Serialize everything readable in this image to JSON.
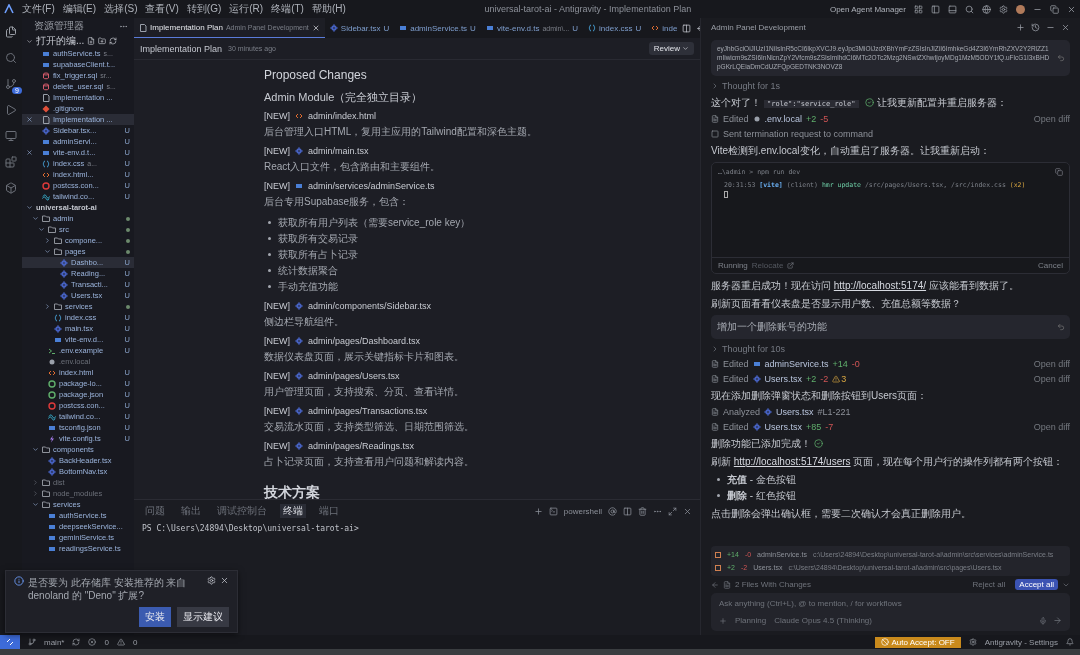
{
  "title_bar": {
    "menu": [
      "文件(F)",
      "编辑(E)",
      "选择(S)",
      "查看(V)",
      "转到(G)",
      "运行(R)",
      "终端(T)",
      "帮助(H)"
    ],
    "title": "universal-tarot-ai - Antigravity - Implementation Plan",
    "agent_manager": "Open Agent Manager"
  },
  "activity_bar": {
    "scm_badge": "9"
  },
  "explorer": {
    "title": "资源管理器",
    "open_editors_label": "打开的编...",
    "open_editors": [
      {
        "name": "authService.ts",
        "detail": "s...",
        "kind": "ts",
        "selected": false,
        "closable": false
      },
      {
        "name": "supabaseClient.t...",
        "kind": "ts",
        "selected": false,
        "closable": false
      },
      {
        "name": "fix_trigger.sql",
        "detail": "sr...",
        "kind": "sql",
        "selected": false,
        "closable": false
      },
      {
        "name": "delete_user.sql",
        "detail": "s...",
        "kind": "sql",
        "selected": false,
        "closable": false
      },
      {
        "name": "Implementation ...",
        "kind": "md",
        "selected": false,
        "closable": false
      },
      {
        "name": ".gitignore",
        "kind": "git",
        "selected": false,
        "closable": false
      },
      {
        "name": "Implementation ...",
        "kind": "md",
        "selected": true,
        "closable": true
      },
      {
        "name": "Sidebar.tsx...",
        "badge": "U",
        "kind": "tsx",
        "selected": false,
        "closable": false
      },
      {
        "name": "adminServi...",
        "badge": "U",
        "kind": "ts",
        "selected": false,
        "closable": false
      },
      {
        "name": "vite-env.d.t...",
        "badge": "U",
        "kind": "ts",
        "selected": false,
        "closable": true
      },
      {
        "name": "index.css",
        "detail": "a...",
        "badge": "U",
        "kind": "css",
        "selected": false,
        "closable": false
      },
      {
        "name": "index.html...",
        "badge": "U",
        "kind": "html",
        "selected": false,
        "closable": false
      },
      {
        "name": "postcss.con...",
        "badge": "U",
        "kind": "postcss",
        "selected": false,
        "closable": false
      },
      {
        "name": "tailwind.co...",
        "badge": "U",
        "kind": "tailwind",
        "selected": false,
        "closable": false
      }
    ],
    "tree": [
      {
        "name": "universal-tarot-ai",
        "kind": "root",
        "expanded": true,
        "children": [
          {
            "name": "admin",
            "kind": "folder",
            "expanded": true,
            "modified": true,
            "children": [
              {
                "name": "src",
                "kind": "folder",
                "expanded": true,
                "modified": true,
                "children": [
                  {
                    "name": "compone...",
                    "kind": "folder",
                    "expanded": false,
                    "modified": true
                  },
                  {
                    "name": "pages",
                    "kind": "folder",
                    "expanded": true,
                    "modified": true,
                    "children": [
                      {
                        "name": "Dashbo...",
                        "kind": "tsx",
                        "badge": "U",
                        "selected": true
                      },
                      {
                        "name": "Reading...",
                        "kind": "tsx",
                        "badge": "U",
                        "selected": false
                      },
                      {
                        "name": "Transacti...",
                        "kind": "tsx",
                        "badge": "U",
                        "selected": false
                      },
                      {
                        "name": "Users.tsx",
                        "kind": "tsx",
                        "badge": "U",
                        "selected": false
                      }
                    ]
                  },
                  {
                    "name": "services",
                    "kind": "folder",
                    "expanded": false,
                    "modified": true
                  },
                  {
                    "name": "index.css",
                    "kind": "css",
                    "badge": "U"
                  },
                  {
                    "name": "main.tsx",
                    "kind": "tsx",
                    "badge": "U"
                  },
                  {
                    "name": "vite-env.d...",
                    "kind": "ts",
                    "badge": "U"
                  }
                ]
              },
              {
                "name": ".env.example",
                "kind": "sh",
                "badge": "U"
              },
              {
                "name": ".env.local",
                "kind": "env",
                "ignored": true
              },
              {
                "name": "index.html",
                "kind": "html",
                "badge": "U"
              },
              {
                "name": "package-lo...",
                "kind": "json",
                "badge": "U"
              },
              {
                "name": "package.json",
                "kind": "json",
                "badge": "U"
              },
              {
                "name": "postcss.con...",
                "kind": "postcss",
                "badge": "U"
              },
              {
                "name": "tailwind.co...",
                "kind": "tailwind",
                "badge": "U"
              },
              {
                "name": "tsconfig.json",
                "kind": "ts",
                "badge": "U"
              },
              {
                "name": "vite.config.ts",
                "kind": "vite",
                "badge": "U"
              }
            ]
          },
          {
            "name": "components",
            "kind": "folder",
            "expanded": true,
            "children": [
              {
                "name": "BackHeader.tsx",
                "kind": "tsx"
              },
              {
                "name": "BottomNav.tsx",
                "kind": "tsx"
              }
            ]
          },
          {
            "name": "dist",
            "kind": "folder",
            "expanded": false,
            "ignored": true
          },
          {
            "name": "node_modules",
            "kind": "folder",
            "expanded": false,
            "ignored": true
          },
          {
            "name": "services",
            "kind": "folder",
            "expanded": true,
            "children": [
              {
                "name": "authService.ts",
                "kind": "ts"
              },
              {
                "name": "deepseekService...",
                "kind": "ts"
              },
              {
                "name": "geminiService.ts",
                "kind": "ts"
              },
              {
                "name": "readingsService.ts",
                "kind": "ts"
              }
            ]
          }
        ]
      }
    ]
  },
  "editor": {
    "tabs": [
      {
        "label": "Implementation Plan",
        "detail": "Admin Panel Development",
        "kind": "md",
        "selected": true
      },
      {
        "label": "Sidebar.tsx",
        "badge": "U",
        "kind": "tsx",
        "selected": false
      },
      {
        "label": "adminService.ts",
        "badge": "U",
        "kind": "ts",
        "selected": false
      },
      {
        "label": "vite-env.d.ts",
        "detail": "admin\\...",
        "badge": "U",
        "kind": "ts",
        "selected": false
      },
      {
        "label": "index.css",
        "badge": "U",
        "kind": "css",
        "selected": false
      },
      {
        "label": "inde",
        "kind": "html",
        "selected": false
      }
    ],
    "doc_title": "Implementation Plan",
    "doc_time": "30 minutes ago",
    "review": "Review",
    "heading": "Proposed Changes",
    "subheading": "Admin Module（完全独立目录）",
    "changes": [
      {
        "tag": "[NEW]",
        "kind": "html",
        "path": "admin/index.html",
        "description": "后台管理入口HTML，复用主应用的Tailwind配置和深色主题。"
      },
      {
        "tag": "[NEW]",
        "kind": "tsx",
        "path": "admin/main.tsx",
        "description": "React入口文件，包含路由和主要组件。"
      },
      {
        "tag": "[NEW]",
        "kind": "ts",
        "path": "admin/services/adminService.ts",
        "description": "后台专用Supabase服务，包含：",
        "bullets": [
          "获取所有用户列表（需要service_role key）",
          "获取所有交易记录",
          "获取所有占卜记录",
          "统计数据聚合",
          "手动充值功能"
        ]
      },
      {
        "tag": "[NEW]",
        "kind": "tsx",
        "path": "admin/components/Sidebar.tsx",
        "description": "侧边栏导航组件。"
      },
      {
        "tag": "[NEW]",
        "kind": "tsx",
        "path": "admin/pages/Dashboard.tsx",
        "description": "数据仪表盘页面，展示关键指标卡片和图表。"
      },
      {
        "tag": "[NEW]",
        "kind": "tsx",
        "path": "admin/pages/Users.tsx",
        "description": "用户管理页面，支持搜索、分页、查看详情。"
      },
      {
        "tag": "[NEW]",
        "kind": "tsx",
        "path": "admin/pages/Transactions.tsx",
        "description": "交易流水页面，支持类型筛选、日期范围筛选。"
      },
      {
        "tag": "[NEW]",
        "kind": "tsx",
        "path": "admin/pages/Readings.tsx",
        "description": "占卜记录页面，支持查看用户问题和解读内容。"
      }
    ],
    "section2": "技术方案"
  },
  "terminal": {
    "tabs": [
      {
        "label": "问题",
        "selected": false
      },
      {
        "label": "输出",
        "selected": false
      },
      {
        "label": "调试控制台",
        "selected": false
      },
      {
        "label": "终端",
        "selected": true
      },
      {
        "label": "端口",
        "selected": false
      }
    ],
    "shell": "powershell",
    "line": "PS C:\\Users\\24894\\Desktop\\universal-tarot-ai>"
  },
  "notification": {
    "message": "是否要为 此存储库 安装推荐的 来自 denoland 的 \"Deno\" 扩展?",
    "buttons": [
      {
        "label": "安装",
        "kind": "primary"
      },
      {
        "label": "显示建议",
        "kind": "secondary"
      }
    ]
  },
  "status_bar": {
    "branch": "main*",
    "errors": "0",
    "warnings": "0",
    "auto_accept": "Auto Accept: OFF",
    "settings": "Antigravity - Settings"
  },
  "agent": {
    "title": "Admin Panel Development",
    "messages": [
      {
        "kind": "user",
        "mono": true,
        "text": "eyJhbGciOiJIUzI1NiIsInR5cCI6IkpXVCJ9.eyJpc3MiOiJzdXBhYmFzZSIsInJlZiI6ImhkeGd4Z3I6YmRhZXV2Y2RlZZ1mIiwicm9sZSI6InNlcnZpY2Vfcm9sZSIsImlhdCI6MTc2OTc2Mzg2NSwiZXhwIjoyMDg1MzM5ODY1fQ.uFlcG1I3xBHDpGKrLQEiaDmCdUZFQpGEDTNK3NOVZ8"
      },
      {
        "kind": "thought",
        "text": "Thought for 1s"
      },
      {
        "kind": "text",
        "parts": [
          {
            "kind": "text",
            "text": "这个对了！"
          },
          {
            "kind": "code",
            "text": "\"role\":\"service_role\""
          },
          {
            "kind": "check"
          },
          {
            "kind": "text",
            "text": "让我更新配置并重启服务器："
          }
        ]
      },
      {
        "kind": "step",
        "verb": "Edited",
        "file": {
          "kind": "env",
          "name": ".env.local"
        },
        "added": "+2",
        "removed": "-5",
        "action": "Open diff"
      },
      {
        "kind": "notice",
        "text": "Sent termination request to command"
      },
      {
        "kind": "text",
        "parts": [
          {
            "kind": "text",
            "text": "Vite检测到.env.local变化，自动重启了服务器。让我重新启动："
          }
        ]
      },
      {
        "kind": "terminal",
        "prompt": "…\\admin > npm run dev",
        "time": "20:31:53",
        "tag": "[vite]",
        "scope": "(client)",
        "event": "hmr update",
        "files": "/src/pages/Users.tsx, /src/index.css",
        "count": "(x2)",
        "status": "Running",
        "relocate": "Relocate",
        "cancel": "Cancel"
      },
      {
        "kind": "text",
        "parts": [
          {
            "kind": "text",
            "text": "服务器重启成功！现在访问 "
          },
          {
            "kind": "link",
            "text": "http://localhost:5174/"
          },
          {
            "kind": "text",
            "text": " 应该能看到数据了。"
          }
        ]
      },
      {
        "kind": "text",
        "parts": [
          {
            "kind": "text",
            "text": "刷新页面看看仪表盘是否显示用户数、充值总额等数据？"
          }
        ]
      },
      {
        "kind": "user",
        "mono": false,
        "text": "增加一个删除账号的功能"
      },
      {
        "kind": "thought",
        "text": "Thought for 10s"
      },
      {
        "kind": "step",
        "verb": "Edited",
        "file": {
          "kind": "ts",
          "name": "adminService.ts"
        },
        "added": "+14",
        "removed": "-0",
        "action": "Open diff"
      },
      {
        "kind": "step",
        "verb": "Edited",
        "file": {
          "kind": "tsx",
          "name": "Users.tsx"
        },
        "added": "+2",
        "removed": "-2",
        "warnings": "3",
        "action": "Open diff"
      },
      {
        "kind": "text",
        "parts": [
          {
            "kind": "text",
            "text": "现在添加删除弹窗状态和删除按钮到Users页面："
          }
        ]
      },
      {
        "kind": "step",
        "verb": "Analyzed",
        "file": {
          "kind": "tsx",
          "name": "Users.tsx"
        },
        "suffix": "#L1-221"
      },
      {
        "kind": "step",
        "verb": "Edited",
        "file": {
          "kind": "tsx",
          "name": "Users.tsx"
        },
        "added": "+85",
        "removed": "-7",
        "action": "Open diff"
      },
      {
        "kind": "text",
        "parts": [
          {
            "kind": "text",
            "text": "删除功能已添加完成！"
          },
          {
            "kind": "check"
          }
        ]
      },
      {
        "kind": "text",
        "parts": [
          {
            "kind": "text",
            "text": "刷新 "
          },
          {
            "kind": "link",
            "text": "http://localhost:5174/users"
          },
          {
            "kind": "text",
            "text": " 页面，现在每个用户行的操作列都有两个按钮："
          }
        ]
      },
      {
        "kind": "bullets",
        "items": [
          "**充值** - 金色按钮",
          "**删除** - 红色按钮"
        ]
      },
      {
        "kind": "text",
        "parts": [
          {
            "kind": "text",
            "text": "点击删除会弹出确认框，需要二次确认才会真正删除用户。"
          }
        ]
      }
    ],
    "changed_files": [
      {
        "added": "+14",
        "removed": "-0",
        "name": "adminService.ts",
        "path": "c:\\Users\\24894\\Desktop\\universal-tarot-ai\\admin\\src\\services\\adminService.ts"
      },
      {
        "added": "+2",
        "removed": "-2",
        "name": "Users.tsx",
        "path": "c:\\Users\\24894\\Desktop\\universal-tarot-ai\\admin\\src\\pages\\Users.tsx"
      }
    ],
    "changes_summary": "2 Files With Changes",
    "reject": "Reject all",
    "accept": "Accept all",
    "input": {
      "placeholder": "Ask anything (Ctrl+L), @ to mention, / for workflows",
      "mode": "Planning",
      "model": "Claude Opus 4.5 (Thinking)"
    }
  }
}
